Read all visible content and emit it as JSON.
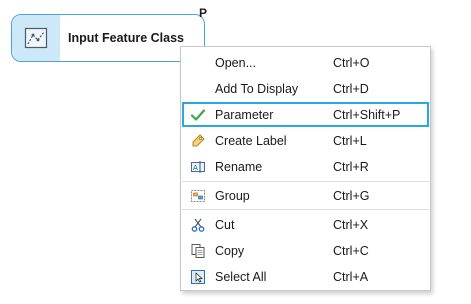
{
  "node": {
    "label": "Input Feature Class",
    "parameter_flag": "P",
    "icon": "feature-class-icon"
  },
  "menu": {
    "items": [
      {
        "label": "Open...",
        "shortcut": "Ctrl+O",
        "icon": ""
      },
      {
        "label": "Add To Display",
        "shortcut": "Ctrl+D",
        "icon": ""
      },
      {
        "label": "Parameter",
        "shortcut": "Ctrl+Shift+P",
        "icon": "checkmark-icon",
        "checked": true
      },
      {
        "label": "Create Label",
        "shortcut": "Ctrl+L",
        "icon": "label-tag-icon"
      },
      {
        "label": "Rename",
        "shortcut": "Ctrl+R",
        "icon": "rename-icon"
      },
      {
        "label": "Group",
        "shortcut": "Ctrl+G",
        "icon": "group-icon"
      },
      {
        "label": "Cut",
        "shortcut": "Ctrl+X",
        "icon": "scissors-icon"
      },
      {
        "label": "Copy",
        "shortcut": "Ctrl+C",
        "icon": "copy-icon"
      },
      {
        "label": "Select All",
        "shortcut": "Ctrl+A",
        "icon": "select-all-icon"
      }
    ]
  },
  "colors": {
    "node_border": "#4aa3df",
    "node_icon_bg": "#cde8f7",
    "selection_border": "#27a9e1",
    "check_green": "#3aa845"
  }
}
